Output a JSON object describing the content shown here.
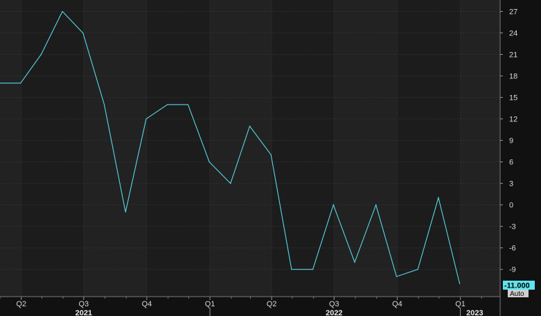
{
  "chart_data": {
    "type": "line",
    "title": "",
    "xlabel": "",
    "ylabel": "",
    "grid": true,
    "colors": {
      "background": "#222222",
      "plot_band_alt": "#1c1c1c",
      "grid": "#3a3a3a",
      "series_line": "#58d9e8",
      "last_value_box": "#5fe3ee",
      "auto_box": "#cfcfcf"
    },
    "ylim": [
      -12.8,
      28.6
    ],
    "yticks": [
      27,
      24,
      21,
      18,
      15,
      12,
      9,
      6,
      3,
      0,
      -3,
      -6,
      -9
    ],
    "ytick_labels": [
      "27",
      "24",
      "21",
      "18",
      "15",
      "12",
      "9",
      "6",
      "3",
      "0",
      "-3",
      "-6",
      "-9"
    ],
    "x_start": "2021-03-01",
    "x_end": "2023-02-28",
    "quarter_ticks": [
      {
        "label": "Q2",
        "date": "2021-04-01"
      },
      {
        "label": "Q3",
        "date": "2021-07-01"
      },
      {
        "label": "Q4",
        "date": "2021-10-01"
      },
      {
        "label": "Q1",
        "date": "2022-01-01"
      },
      {
        "label": "Q2",
        "date": "2022-04-01"
      },
      {
        "label": "Q3",
        "date": "2022-07-01"
      },
      {
        "label": "Q4",
        "date": "2022-10-01"
      },
      {
        "label": "Q1",
        "date": "2023-01-01"
      }
    ],
    "year_labels": [
      {
        "label": "2021",
        "mid": "2021-07-01"
      },
      {
        "label": "2022",
        "mid": "2022-07-01"
      },
      {
        "label": "2023",
        "mid": "2023-01-22"
      }
    ],
    "series": [
      {
        "dates": [
          "2021-03-01",
          "2021-03-31",
          "2021-04-30",
          "2021-05-31",
          "2021-06-30",
          "2021-07-31",
          "2021-08-31",
          "2021-09-30",
          "2021-10-31",
          "2021-11-30",
          "2021-12-31",
          "2022-01-31",
          "2022-02-28",
          "2022-03-31",
          "2022-04-30",
          "2022-05-31",
          "2022-06-30",
          "2022-07-31",
          "2022-08-31",
          "2022-09-30",
          "2022-10-31",
          "2022-11-30",
          "2022-12-31",
          "2023-01-31"
        ],
        "values": [
          17,
          17,
          21,
          27,
          24,
          14,
          -1,
          12,
          14,
          14,
          6,
          3,
          11,
          7,
          -9,
          -9,
          0,
          -8,
          0,
          -10,
          -9,
          1,
          -11
        ]
      }
    ],
    "last_value_label": "-11.000",
    "auto_label": "Auto"
  }
}
